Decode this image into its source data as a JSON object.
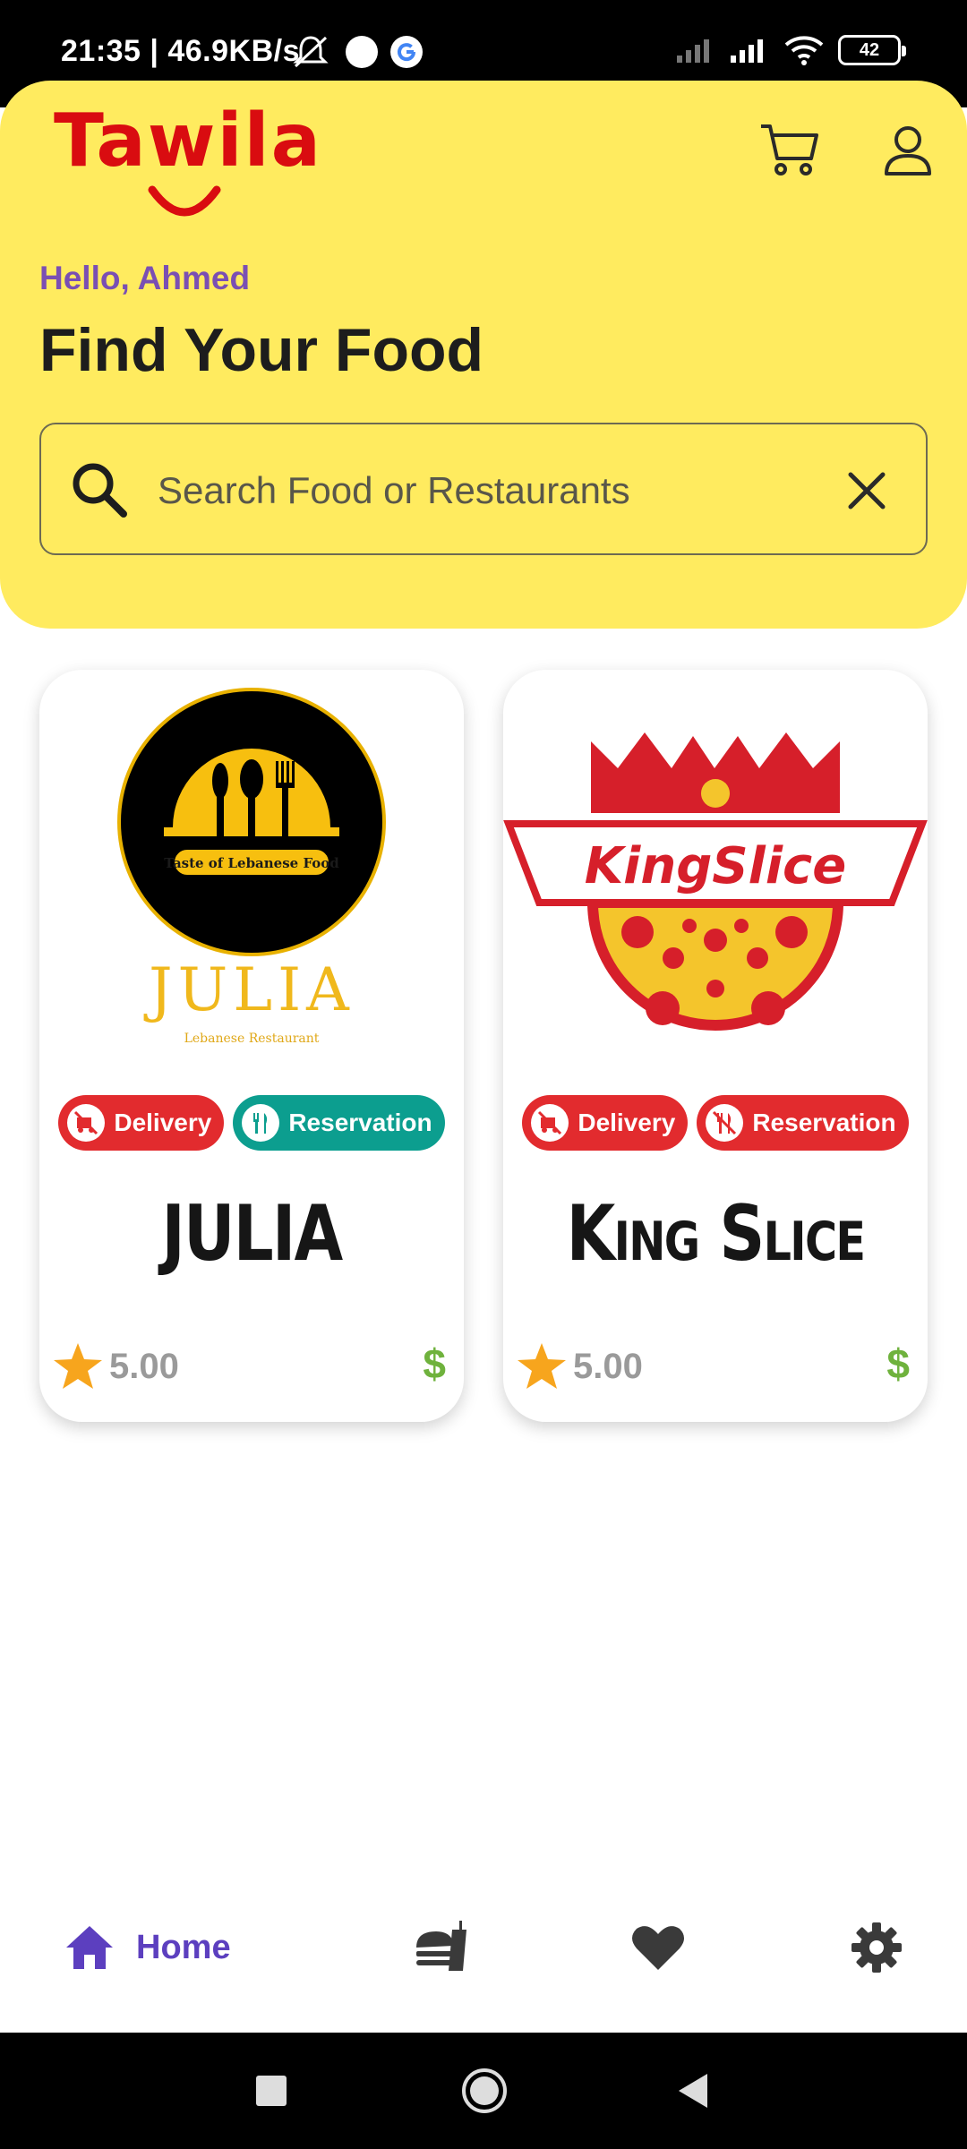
{
  "status_bar": {
    "time_speed": "21:35 | 46.9KB/s",
    "battery": "42"
  },
  "header": {
    "logo_text": "Tawila",
    "greeting": "Hello, Ahmed",
    "title": "Find Your Food",
    "search": {
      "placeholder": "Search Food or Restaurants"
    }
  },
  "restaurants": [
    {
      "name": "JULIA",
      "logo_text": "JULIA",
      "logo_subtext": "Lebanese Restaurant",
      "logo_ribbon": "Taste of Lebanese Food",
      "badges": [
        "Delivery",
        "Reservation"
      ],
      "rating": "5.00",
      "price": "$"
    },
    {
      "name": "King Slice",
      "logo_text": "KingSlice",
      "badges": [
        "Delivery",
        "Reservation"
      ],
      "rating": "5.00",
      "price": "$"
    }
  ],
  "bottom_nav": {
    "home_label": "Home"
  },
  "colors": {
    "header_bg": "#ffeb5f",
    "brand_red": "#d90c10",
    "accent_purple": "#5c3fbf",
    "badge_red": "#e22b2e",
    "badge_teal": "#0c9e8f",
    "price_green": "#6fb23d"
  }
}
